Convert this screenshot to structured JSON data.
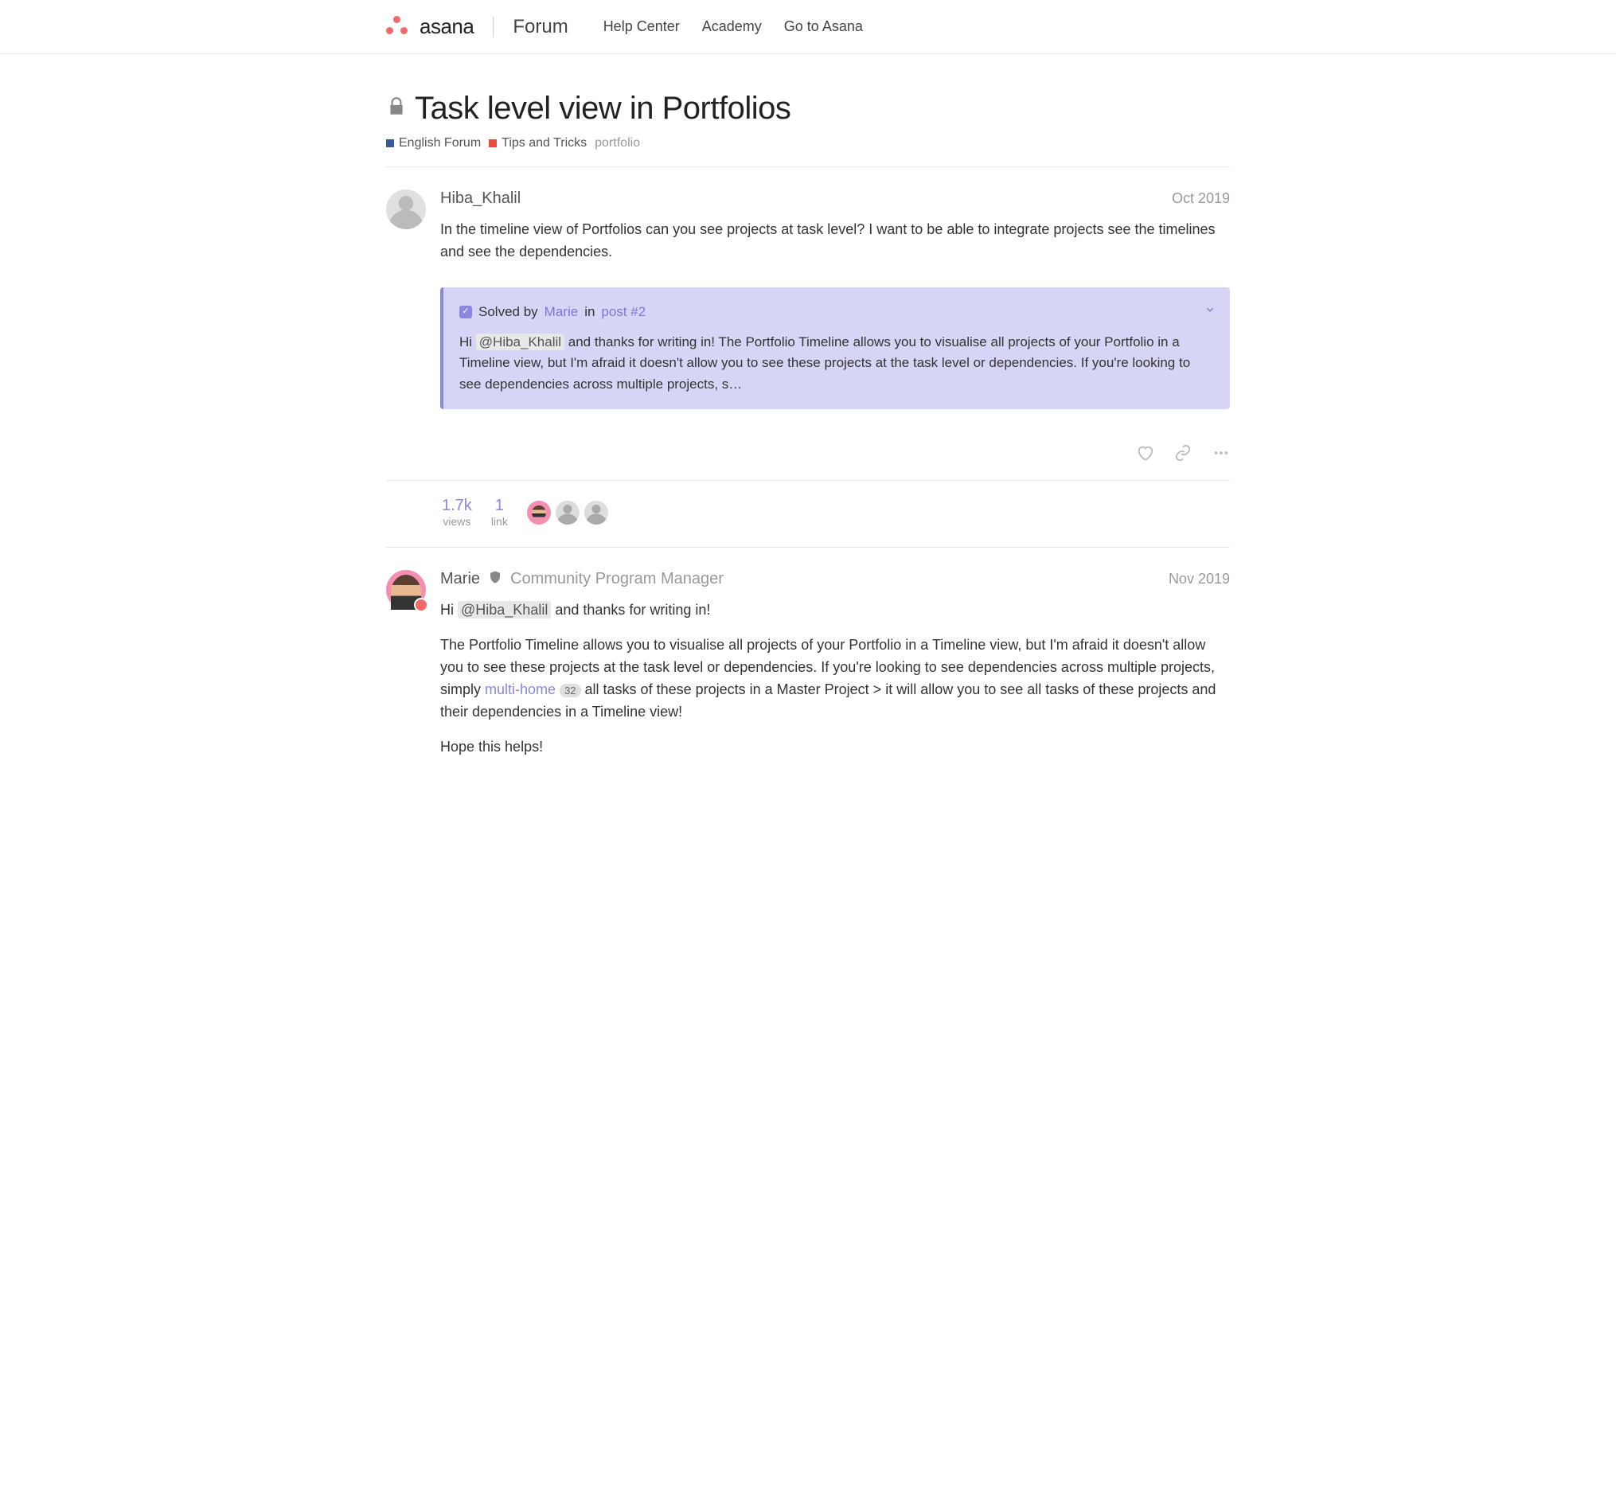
{
  "header": {
    "brand": "asana",
    "forum_label": "Forum",
    "nav": [
      "Help Center",
      "Academy",
      "Go to Asana"
    ]
  },
  "topic": {
    "title": "Task level view in Portfolios",
    "categories": [
      {
        "name": "English Forum",
        "color": "blue"
      },
      {
        "name": "Tips and Tricks",
        "color": "red"
      }
    ],
    "tag": "portfolio"
  },
  "posts": [
    {
      "author": "Hiba_Khalil",
      "date": "Oct 2019",
      "body": "In the timeline view of Portfolios can you see projects at task level? I want to be able to integrate projects see the timelines and see the dependencies.",
      "solution": {
        "solved_by_pre": "Solved by",
        "solver": "Marie",
        "in": "in",
        "post_ref": "post #2",
        "text_pre": "Hi ",
        "mention": "@Hiba_Khalil",
        "text_post": " and thanks for writing in! The Portfolio Timeline allows you to visualise all projects of your Portfolio in a Timeline view, but I'm afraid it doesn't allow you to see these projects at the task level or dependencies. If you're looking to see dependencies across multiple projects, s…"
      }
    },
    {
      "author": "Marie",
      "role": "Community Program Manager",
      "date": "Nov 2019",
      "greeting_pre": "Hi ",
      "mention": "@Hiba_Khalil",
      "greeting_post": " and thanks for writing in!",
      "body_pre": "The Portfolio Timeline allows you to visualise all projects of your Portfolio in a Timeline view, but I'm afraid it doesn't allow you to see these projects at the task level or dependencies. If you're looking to see dependencies across multiple projects, simply ",
      "link_text": "multi-home",
      "link_badge": "32",
      "body_post": " all tasks of these projects in a Master Project > it will allow you to see all tasks of these projects and their dependencies in a Timeline view!",
      "closing": "Hope this helps!"
    }
  ],
  "stats": {
    "views_num": "1.7k",
    "views_lbl": "views",
    "link_num": "1",
    "link_lbl": "link"
  }
}
